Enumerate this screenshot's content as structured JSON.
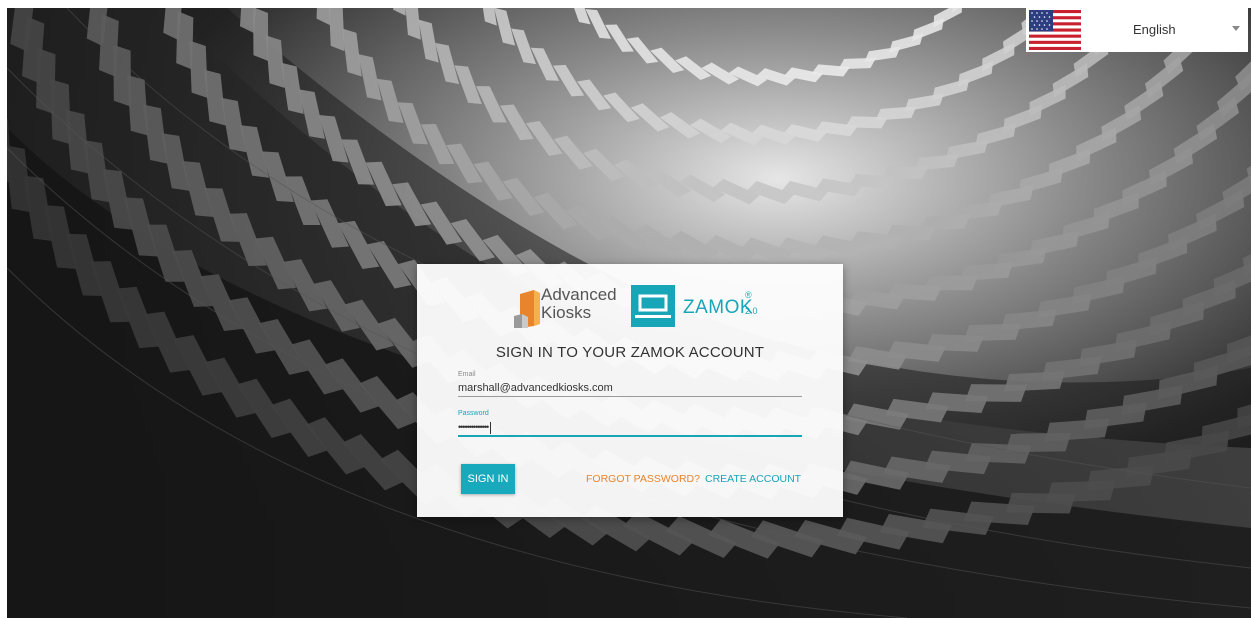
{
  "language_selector": {
    "current": "English",
    "flag_icon": "us-flag-icon"
  },
  "branding": {
    "advanced_kiosks": {
      "line1": "Advanced",
      "line2": "Kiosks"
    },
    "zamok": {
      "name": "ZAMOK",
      "registered": "®",
      "version": "2.0"
    }
  },
  "signin": {
    "title": "SIGN IN TO YOUR ZAMOK ACCOUNT",
    "email_label": "Email",
    "email_value": "marshall@advancedkiosks.com",
    "password_label": "Password",
    "password_value": "••••••••••••••",
    "signin_button": "SIGN IN",
    "forgot_link": "FORGOT PASSWORD?",
    "create_link": "CREATE ACCOUNT"
  },
  "colors": {
    "accent_teal": "#16a6b8",
    "link_orange": "#e8842b"
  }
}
